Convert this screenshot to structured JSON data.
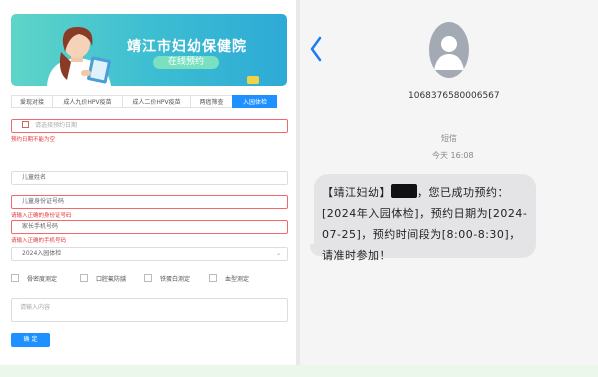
{
  "form": {
    "banner": {
      "title": "靖江市妇幼保健院",
      "subtitle": "在线预约"
    },
    "tabs": [
      {
        "label": "爱现对接"
      },
      {
        "label": "成人九价HPV疫苗"
      },
      {
        "label": "成人二价HPV疫苗"
      },
      {
        "label": "两癌筛查"
      },
      {
        "label": "入园体检"
      }
    ],
    "date_field": {
      "placeholder": "请选择预约日期",
      "error": "预约日期不能为空"
    },
    "child_name": {
      "placeholder": "儿童姓名"
    },
    "id_field": {
      "placeholder": "儿童身份证号码",
      "error": "请输入正确的身份证号码"
    },
    "phone_field": {
      "placeholder": "家长手机号码",
      "error": "请输入正确的手机号码"
    },
    "exam_select": {
      "value": "2024入园体检"
    },
    "checkboxes": [
      {
        "label": "骨密度测定"
      },
      {
        "label": "口腔氟防龋"
      },
      {
        "label": "铁蛋白测定"
      },
      {
        "label": "血型测定"
      }
    ],
    "notes": {
      "placeholder": "请输入内容"
    },
    "confirm_label": "确 定"
  },
  "sms": {
    "phone": "1068376580006567",
    "label": "短信",
    "time": "今天 16:08",
    "message_prefix": "【靖江妇幼】",
    "message_body": "，您已成功预约：[2024年入园体检]，预约日期为[2024-07-25]，预约时间段为[8:00-8:30]，请准时参加！"
  },
  "colors": {
    "primary": "#1e90ff",
    "error": "#e23a3a",
    "banner_start": "#5fd5c8",
    "banner_end": "#2eaad6",
    "back_arrow": "#1e7cf0"
  }
}
